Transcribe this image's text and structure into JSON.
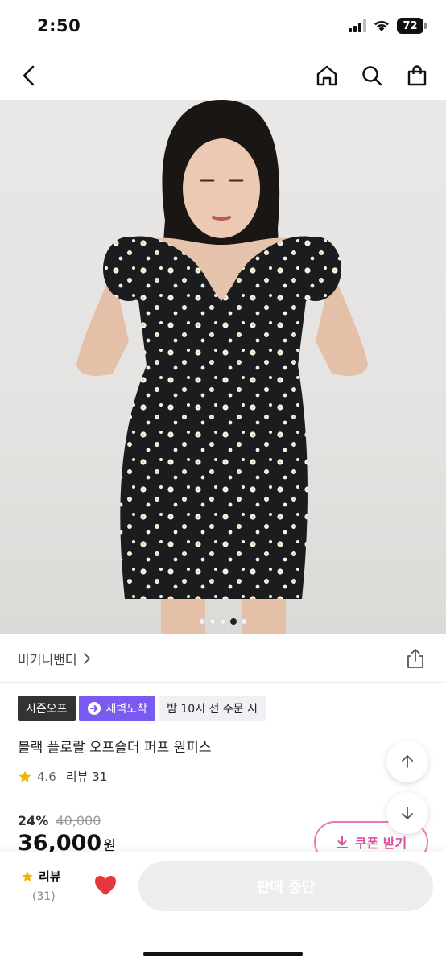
{
  "status_bar": {
    "time": "2:50",
    "battery": "72"
  },
  "nav": {
    "back_icon": "chevron-left-icon",
    "icons": [
      "home-icon",
      "search-icon",
      "bag-icon"
    ]
  },
  "gallery": {
    "total": 5,
    "active_index": 3
  },
  "product": {
    "brand": "비키니밴더",
    "badges": {
      "season": "시즌오프",
      "dawn": "새벽도착",
      "cutoff": "밤 10시 전 주문 시"
    },
    "title": "블랙 플로랄 오프숄더 퍼프 원피스",
    "rating": "4.6",
    "review_link": "리뷰 31",
    "discount": "24%",
    "original_price": "40,000",
    "price": "36,000",
    "currency": "원",
    "coupon": "쿠폰 받기"
  },
  "bottom_bar": {
    "review_label": "리뷰",
    "review_count": "(31)",
    "buy_label": "판매 중단"
  },
  "colors": {
    "accent_purple": "#7a5af0",
    "coupon_pink": "#e879b8",
    "heart_red": "#e8363c",
    "star": "#f5b301"
  }
}
